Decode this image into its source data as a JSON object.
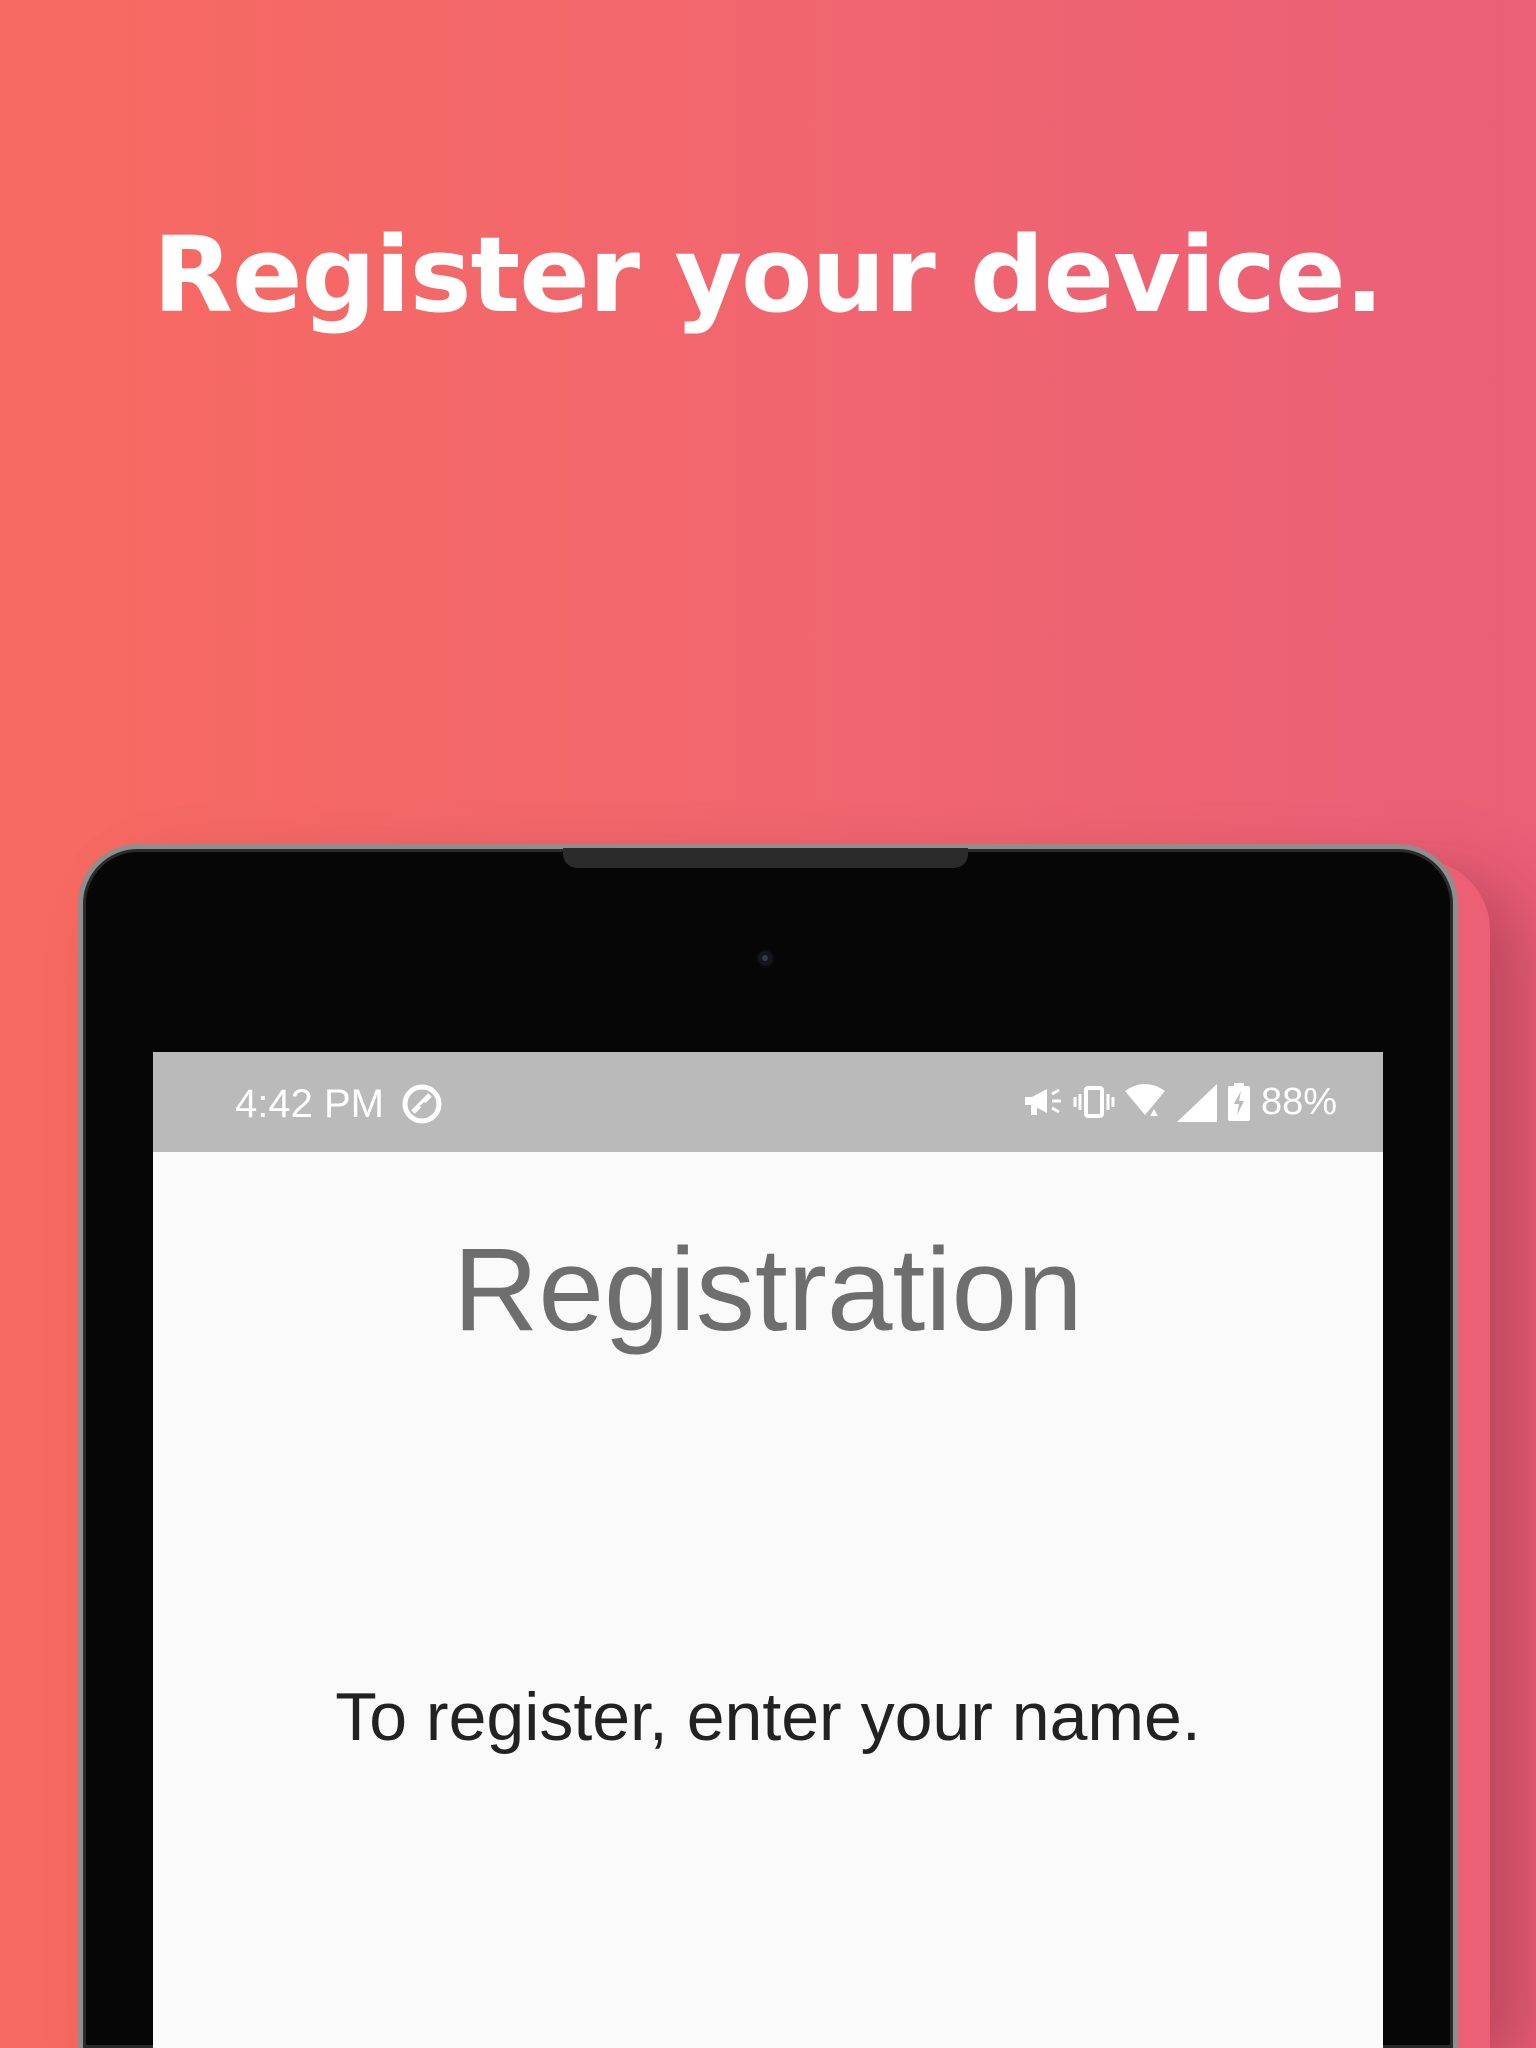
{
  "promo": {
    "headline": "Register your device."
  },
  "status_bar": {
    "time": "4:42 PM",
    "left_icon": "data-saver-icon",
    "icons": [
      "megaphone-icon",
      "vibrate-icon",
      "wifi-icon",
      "cell-signal-icon",
      "battery-charging-icon"
    ],
    "battery": "88%"
  },
  "app": {
    "title": "Registration",
    "instruction": "To register, enter your name."
  },
  "colors": {
    "gradient_left": "#F76A61",
    "gradient_right": "#EB5F77",
    "status_bar": "#BABABA",
    "screen_background": "#FAFAFA",
    "title_text": "#6E6E6E",
    "body_text": "#222222"
  }
}
